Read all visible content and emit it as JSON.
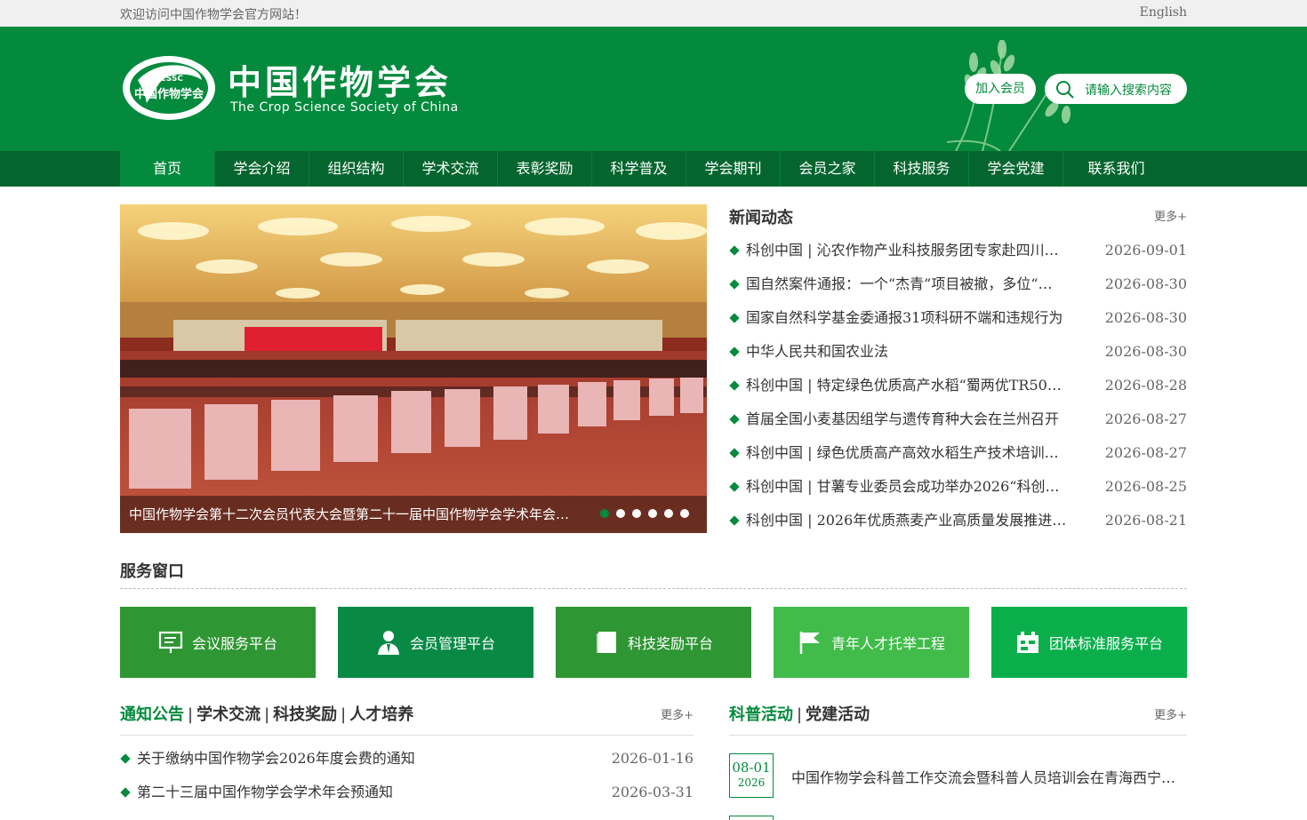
{
  "topbar": {
    "welcome": "欢迎访问中国作物学会官方网站！",
    "english": "English"
  },
  "header": {
    "logo_cn": "中国作物学会",
    "logo_en": "The Crop Science Society of China",
    "logo_badge_top": "CSSC",
    "logo_badge_text": "中国作物学会",
    "join_label": "加入会员",
    "search_placeholder": "请输入搜索内容"
  },
  "nav": [
    "首页",
    "学会介绍",
    "组织结构",
    "学术交流",
    "表彰奖励",
    "科学普及",
    "学会期刊",
    "会员之家",
    "科技服务",
    "学会党建",
    "联系我们"
  ],
  "carousel": {
    "caption": "中国作物学会第十二次会员代表大会暨第二十一届中国作物学会学术年会…",
    "slide_count": 6,
    "active_index": 0
  },
  "news": {
    "title": "新闻动态",
    "more": "更多+",
    "items": [
      {
        "title": "科创中国 | 沁农作物产业科技服务团专家赴四川…",
        "date": "2026-09-01"
      },
      {
        "title": "国自然案件通报：一个“杰青”项目被撤，多位“…",
        "date": "2026-08-30"
      },
      {
        "title": "国家自然科学基金委通报31项科研不端和违规行为",
        "date": "2026-08-30"
      },
      {
        "title": "中华人民共和国农业法",
        "date": "2026-08-30"
      },
      {
        "title": "科创中国 | 特定绿色优质高产水稻“蜀两优TR50”…",
        "date": "2026-08-28"
      },
      {
        "title": "首届全国小麦基因组学与遗传育种大会在兰州召开",
        "date": "2026-08-27"
      },
      {
        "title": "科创中国 | 绿色优质高产高效水稻生产技术培训…",
        "date": "2026-08-27"
      },
      {
        "title": "科创中国 | 甘薯专业委员会成功举办2026“科创…",
        "date": "2026-08-25"
      },
      {
        "title": "科创中国 | 2026年优质燕麦产业高质量发展推进…",
        "date": "2026-08-21"
      }
    ]
  },
  "services": {
    "title": "服务窗口",
    "cards": [
      {
        "label": "会议服务平台",
        "icon": "presentation-icon",
        "color": "#2e9632"
      },
      {
        "label": "会员管理平台",
        "icon": "member-icon",
        "color": "#088a44"
      },
      {
        "label": "科技奖励平台",
        "icon": "book-icon",
        "color": "#2e9632"
      },
      {
        "label": "青年人才托举工程",
        "icon": "flag-icon",
        "color": "#41bc4a"
      },
      {
        "label": "团体标准服务平台",
        "icon": "standard-icon",
        "color": "#0aaf4c"
      }
    ]
  },
  "notice": {
    "tabs": [
      "通知公告",
      "学术交流",
      "科技奖励",
      "人才培养"
    ],
    "more": "更多+",
    "items": [
      {
        "title": "关于缴纳中国作物学会2026年度会费的通知",
        "date": "2026-01-16"
      },
      {
        "title": "第二十三届中国作物学会学术年会预通知",
        "date": "2026-03-31"
      }
    ]
  },
  "popular": {
    "tabs": [
      "科普活动",
      "党建活动"
    ],
    "more": "更多+",
    "items": [
      {
        "md": "08-01",
        "year": "2026",
        "title": "中国作物学会科普工作交流会暨科普人员培训会在青海西宁…"
      }
    ]
  },
  "colors": {
    "brand_green": "#038a3c",
    "nav_green": "#04662e"
  }
}
